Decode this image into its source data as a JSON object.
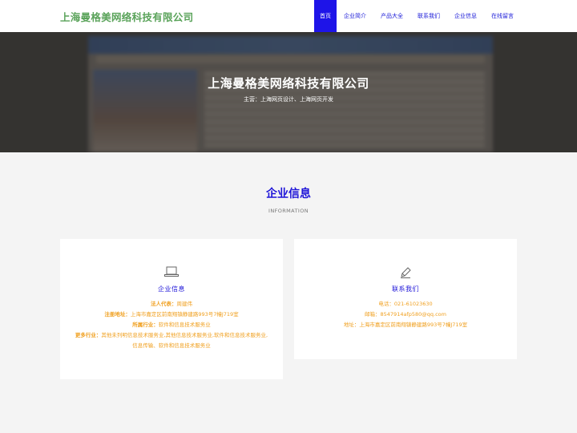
{
  "header": {
    "brand": "上海曼格美网络科技有限公司",
    "nav": [
      {
        "label": "首页",
        "active": true
      },
      {
        "label": "企业简介",
        "active": false
      },
      {
        "label": "产品大全",
        "active": false
      },
      {
        "label": "联系我们",
        "active": false
      },
      {
        "label": "企业信息",
        "active": false
      },
      {
        "label": "在线留言",
        "active": false
      }
    ]
  },
  "hero": {
    "title": "上海曼格美网络科技有限公司",
    "subtitle": "主营：上海网页设计、上海网页开发"
  },
  "section": {
    "title": "企业信息",
    "subtitle": "INFORMATION"
  },
  "company_card": {
    "icon": "laptop-icon",
    "title": "企业信息",
    "rows": [
      {
        "label": "法人代表：",
        "value": "周建伟"
      },
      {
        "label": "注册地址：",
        "value": "上海市嘉定区前南翔镇静建路993号7幢J719室"
      },
      {
        "label": "所属行业：",
        "value": "软件和信息技术服务业"
      },
      {
        "label": "更多行业：",
        "value": "其他未列明信息技术服务业,其他信息技术服务业,软件和信息技术服务业,信息传输、软件和信息技术服务业"
      }
    ]
  },
  "contact_card": {
    "icon": "pencil-icon",
    "title": "联系我们",
    "rows": [
      {
        "label": "电话：",
        "value": "021-61023630"
      },
      {
        "label": "邮箱：",
        "value": "8547914afp580@qq.com"
      },
      {
        "label": "地址：",
        "value": "上海市嘉定区前南翔镇静建路993号7幢J719室"
      }
    ]
  },
  "colors": {
    "accent": "#1e14e8",
    "brand": "#5aa35a",
    "info_text": "#f0a020"
  }
}
